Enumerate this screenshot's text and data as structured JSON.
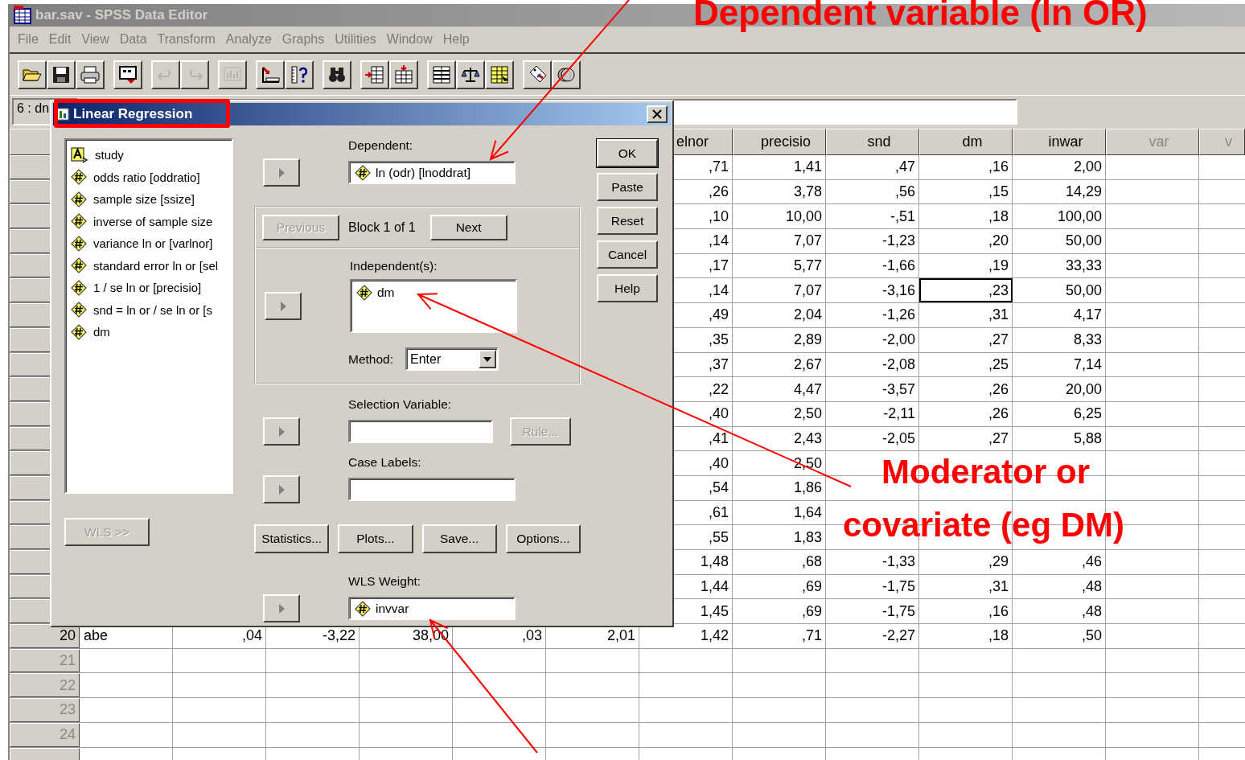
{
  "window": {
    "title": "bar.sav - SPSS Data Editor"
  },
  "menu": [
    "File",
    "Edit",
    "View",
    "Data",
    "Transform",
    "Analyze",
    "Graphs",
    "Utilities",
    "Window",
    "Help"
  ],
  "toolbar": [
    [
      {
        "kind": "open",
        "disabled": false
      },
      {
        "kind": "save",
        "disabled": false
      },
      {
        "kind": "print",
        "disabled": false
      }
    ],
    [
      {
        "kind": "recall",
        "disabled": false
      }
    ],
    [
      {
        "kind": "undo",
        "disabled": true
      },
      {
        "kind": "redo",
        "disabled": true
      }
    ],
    [
      {
        "kind": "chart",
        "disabled": true
      }
    ],
    [
      {
        "kind": "goto",
        "disabled": false
      },
      {
        "kind": "variables",
        "disabled": false
      }
    ],
    [
      {
        "kind": "find",
        "disabled": false
      }
    ],
    [
      {
        "kind": "insert_case",
        "disabled": false
      },
      {
        "kind": "insert_variable",
        "disabled": false
      }
    ],
    [
      {
        "kind": "split",
        "disabled": false
      },
      {
        "kind": "weight",
        "disabled": false
      },
      {
        "kind": "select",
        "disabled": false
      }
    ],
    [
      {
        "kind": "labels",
        "disabled": false
      },
      {
        "kind": "sets",
        "disabled": false
      }
    ]
  ],
  "cell_editor": {
    "reference": "6 : dn"
  },
  "grid": {
    "columns": [
      {
        "label": "elnor",
        "kind": "variable"
      },
      {
        "label": "precisio",
        "kind": "variable"
      },
      {
        "label": "snd",
        "kind": "variable"
      },
      {
        "label": "dm",
        "kind": "variable"
      },
      {
        "label": "inwar",
        "kind": "variable"
      },
      {
        "label": "var",
        "kind": "unused"
      },
      {
        "label": "v",
        "kind": "unused"
      }
    ],
    "rows": [
      {
        "kind": "partial",
        "cells": [
          {
            "text": ",71",
            "selected": false
          },
          {
            "text": "1,41",
            "selected": false
          },
          {
            "text": ",47",
            "selected": false
          },
          {
            "text": ",16",
            "selected": false
          },
          {
            "text": "2,00",
            "selected": false
          }
        ]
      },
      {
        "kind": "partial",
        "cells": [
          {
            "text": ",26",
            "selected": false
          },
          {
            "text": "3,78",
            "selected": false
          },
          {
            "text": ",56",
            "selected": false
          },
          {
            "text": ",15",
            "selected": false
          },
          {
            "text": "14,29",
            "selected": false
          }
        ]
      },
      {
        "kind": "partial",
        "cells": [
          {
            "text": ",10",
            "selected": false
          },
          {
            "text": "10,00",
            "selected": false
          },
          {
            "text": "-,51",
            "selected": false
          },
          {
            "text": ",18",
            "selected": false
          },
          {
            "text": "100,00",
            "selected": false
          }
        ]
      },
      {
        "kind": "partial",
        "cells": [
          {
            "text": ",14",
            "selected": false
          },
          {
            "text": "7,07",
            "selected": false
          },
          {
            "text": "-1,23",
            "selected": false
          },
          {
            "text": ",20",
            "selected": false
          },
          {
            "text": "50,00",
            "selected": false
          }
        ]
      },
      {
        "kind": "partial",
        "cells": [
          {
            "text": ",17",
            "selected": false
          },
          {
            "text": "5,77",
            "selected": false
          },
          {
            "text": "-1,66",
            "selected": false
          },
          {
            "text": ",19",
            "selected": false
          },
          {
            "text": "33,33",
            "selected": false
          }
        ]
      },
      {
        "kind": "partial",
        "cells": [
          {
            "text": ",14",
            "selected": false
          },
          {
            "text": "7,07",
            "selected": false
          },
          {
            "text": "-3,16",
            "selected": false
          },
          {
            "text": ",23",
            "selected": true
          },
          {
            "text": "50,00",
            "selected": false
          }
        ]
      },
      {
        "kind": "partial",
        "cells": [
          {
            "text": ",49",
            "selected": false
          },
          {
            "text": "2,04",
            "selected": false
          },
          {
            "text": "-1,26",
            "selected": false
          },
          {
            "text": ",31",
            "selected": false
          },
          {
            "text": "4,17",
            "selected": false
          }
        ]
      },
      {
        "kind": "partial",
        "cells": [
          {
            "text": ",35",
            "selected": false
          },
          {
            "text": "2,89",
            "selected": false
          },
          {
            "text": "-2,00",
            "selected": false
          },
          {
            "text": ",27",
            "selected": false
          },
          {
            "text": "8,33",
            "selected": false
          }
        ]
      },
      {
        "kind": "partial",
        "cells": [
          {
            "text": ",37",
            "selected": false
          },
          {
            "text": "2,67",
            "selected": false
          },
          {
            "text": "-2,08",
            "selected": false
          },
          {
            "text": ",25",
            "selected": false
          },
          {
            "text": "7,14",
            "selected": false
          }
        ]
      },
      {
        "kind": "partial",
        "cells": [
          {
            "text": ",22",
            "selected": false
          },
          {
            "text": "4,47",
            "selected": false
          },
          {
            "text": "-3,57",
            "selected": false
          },
          {
            "text": ",26",
            "selected": false
          },
          {
            "text": "20,00",
            "selected": false
          }
        ]
      },
      {
        "kind": "partial",
        "cells": [
          {
            "text": ",40",
            "selected": false
          },
          {
            "text": "2,50",
            "selected": false
          },
          {
            "text": "-2,11",
            "selected": false
          },
          {
            "text": ",26",
            "selected": false
          },
          {
            "text": "6,25",
            "selected": false
          }
        ]
      },
      {
        "kind": "partial",
        "cells": [
          {
            "text": ",41",
            "selected": false
          },
          {
            "text": "2,43",
            "selected": false
          },
          {
            "text": "-2,05",
            "selected": false
          },
          {
            "text": ",27",
            "selected": false
          },
          {
            "text": "5,88",
            "selected": false
          }
        ]
      },
      {
        "kind": "partial",
        "cells": [
          {
            "text": ",40",
            "selected": false
          },
          {
            "text": "2,50",
            "selected": false
          }
        ]
      },
      {
        "kind": "partial",
        "cells": [
          {
            "text": ",54",
            "selected": false
          },
          {
            "text": "1,86",
            "selected": false
          }
        ]
      },
      {
        "kind": "partial",
        "cells": [
          {
            "text": ",61",
            "selected": false
          },
          {
            "text": "1,64",
            "selected": false
          }
        ]
      },
      {
        "kind": "partial",
        "cells": [
          {
            "text": ",55",
            "selected": false
          },
          {
            "text": "1,83",
            "selected": false
          }
        ]
      },
      {
        "kind": "partial",
        "cells": [
          {
            "text": "1,48",
            "selected": false
          },
          {
            "text": ",68",
            "selected": false
          },
          {
            "text": "-1,33",
            "selected": false
          },
          {
            "text": ",29",
            "selected": false
          },
          {
            "text": ",46",
            "selected": false
          }
        ]
      },
      {
        "kind": "partial",
        "cells": [
          {
            "text": "1,44",
            "selected": false
          },
          {
            "text": ",69",
            "selected": false
          },
          {
            "text": "-1,75",
            "selected": false
          },
          {
            "text": ",31",
            "selected": false
          },
          {
            "text": ",48",
            "selected": false
          }
        ]
      },
      {
        "kind": "partial",
        "cells": [
          {
            "text": "1,45",
            "selected": false
          },
          {
            "text": ",69",
            "selected": false
          },
          {
            "text": "-1,75",
            "selected": false
          },
          {
            "text": ",16",
            "selected": false
          },
          {
            "text": ",48",
            "selected": false
          }
        ]
      },
      {
        "kind": "full",
        "number": "20",
        "cells": [
          {
            "text": "abe",
            "selected": false
          },
          {
            "text": ",04",
            "selected": false
          },
          {
            "text": "-3,22",
            "selected": false
          },
          {
            "text": "38,00",
            "selected": false
          },
          {
            "text": ",03",
            "selected": false
          },
          {
            "text": "2,01",
            "selected": false
          },
          {
            "text": "1,42",
            "selected": false
          },
          {
            "text": ",71",
            "selected": false
          },
          {
            "text": "-2,27",
            "selected": false
          },
          {
            "text": ",18",
            "selected": false
          },
          {
            "text": ",50",
            "selected": false
          }
        ]
      },
      {
        "kind": "blank",
        "number": "21"
      },
      {
        "kind": "blank",
        "number": "22"
      },
      {
        "kind": "blank",
        "number": "23"
      },
      {
        "kind": "blank",
        "number": "24"
      }
    ]
  },
  "dialog": {
    "title": "Linear Regression",
    "variables": [
      {
        "label": "study",
        "kind": "string"
      },
      {
        "label": "odds ratio [oddratio]",
        "kind": "numeric"
      },
      {
        "label": "sample size [ssize]",
        "kind": "numeric"
      },
      {
        "label": "inverse of sample size",
        "kind": "numeric"
      },
      {
        "label": "variance ln or [varlnor]",
        "kind": "numeric"
      },
      {
        "label": "standard error ln or [sel",
        "kind": "numeric"
      },
      {
        "label": "1 / se ln or [precisio]",
        "kind": "numeric"
      },
      {
        "label": "snd = ln or / se ln or [s",
        "kind": "numeric"
      },
      {
        "label": "dm",
        "kind": "numeric"
      }
    ],
    "dependent": {
      "label": "Dependent:",
      "value": {
        "label": "ln (odr) [lnoddrat]",
        "kind": "numeric"
      }
    },
    "block": {
      "previous": {
        "label": "Previous",
        "disabled": true
      },
      "text": "Block 1 of 1",
      "next": {
        "label": "Next",
        "disabled": false
      }
    },
    "independents": {
      "label": "Independent(s):",
      "items": [
        {
          "label": "dm",
          "kind": "numeric"
        }
      ]
    },
    "method": {
      "label": "Method:",
      "value": "Enter"
    },
    "selection_variable": {
      "label": "Selection Variable:",
      "rule": {
        "label": "Rule...",
        "disabled": true
      }
    },
    "case_labels": {
      "label": "Case Labels:"
    },
    "wls_button": {
      "label": "WLS >>",
      "disabled": true
    },
    "option_buttons": [
      "Statistics...",
      "Plots...",
      "Save...",
      "Options..."
    ],
    "wls_weight": {
      "label": "WLS Weight:",
      "value": {
        "label": "invvar",
        "kind": "numeric"
      }
    },
    "buttons": [
      {
        "label": "OK",
        "default": true
      },
      {
        "label": "Paste",
        "default": false
      },
      {
        "label": "Reset",
        "default": false
      },
      {
        "label": "Cancel",
        "default": false
      },
      {
        "label": "Help",
        "default": false
      }
    ]
  },
  "annotations": [
    {
      "text": "Dependent variable (ln OR)",
      "kind": "top"
    },
    {
      "text": "Moderator or",
      "kind": "moderator"
    },
    {
      "text": "covariate (eg DM)",
      "kind": "covariate"
    }
  ]
}
